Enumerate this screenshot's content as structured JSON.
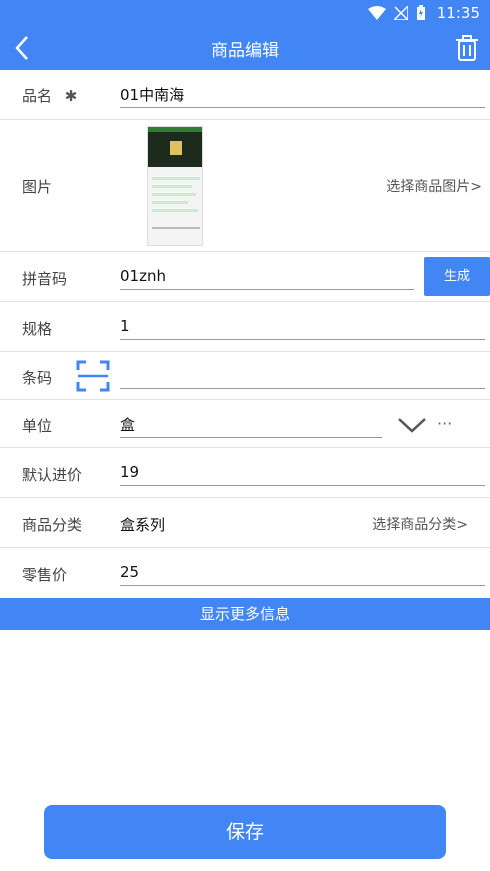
{
  "status_bar": {
    "time": "11:35"
  },
  "header": {
    "title": "商品编辑"
  },
  "form": {
    "name": {
      "label": "品名",
      "required_mark": "✱",
      "value": "01中南海"
    },
    "image": {
      "label": "图片",
      "action": "选择商品图片>"
    },
    "pinyin": {
      "label": "拼音码",
      "value": "01znh",
      "button": "生成"
    },
    "spec": {
      "label": "规格",
      "value": "1"
    },
    "barcode": {
      "label": "条码",
      "value": ""
    },
    "unit": {
      "label": "单位",
      "value": "盒",
      "more": "···"
    },
    "cost": {
      "label": "默认进价",
      "value": "19"
    },
    "category": {
      "label": "商品分类",
      "value": "盒系列",
      "action": "选择商品分类>"
    },
    "price": {
      "label": "零售价",
      "value": "25"
    }
  },
  "more_info": "显示更多信息",
  "save": "保存",
  "colors": {
    "primary": "#4286f5",
    "divider": "#e2e2e2"
  },
  "icons": {
    "back": "chevron-left-icon",
    "delete": "trash-icon",
    "scan": "scan-icon",
    "dropdown": "chevron-down-icon"
  }
}
